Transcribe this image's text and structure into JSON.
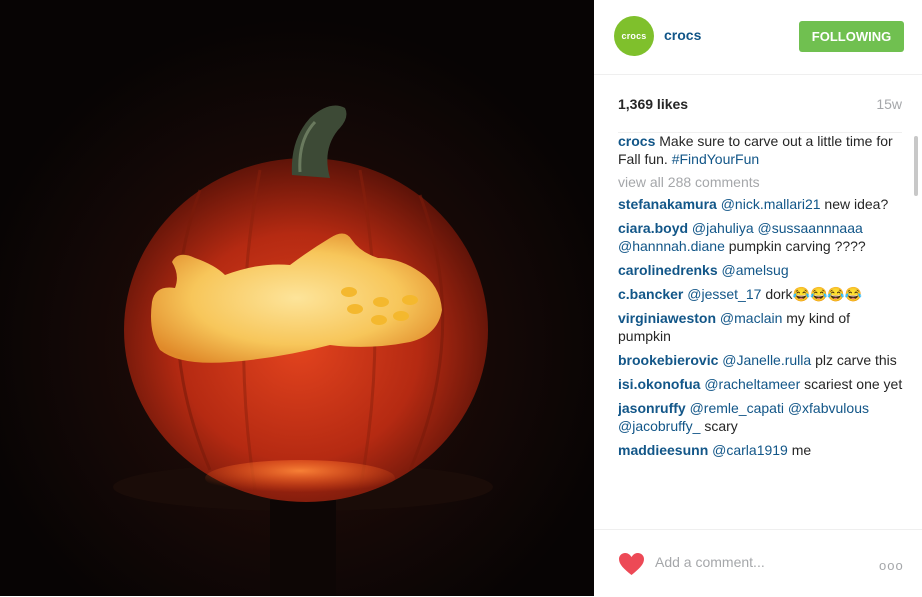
{
  "header": {
    "avatar_text": "crocs",
    "username": "crocs",
    "follow_label": "FOLLOWING",
    "avatar_color": "#7fc02c",
    "follow_color": "#70c050"
  },
  "meta": {
    "likes": "1,369 likes",
    "time": "15w"
  },
  "caption": {
    "author": "crocs",
    "text": "Make sure to carve out a little time for Fall fun.",
    "hashtag": "#FindYourFun"
  },
  "view_all": "view all 288 comments",
  "comments": [
    {
      "author": "stefanakamura",
      "mentions": "@nick.mallari21",
      "text": "new idea?"
    },
    {
      "author": "ciara.boyd",
      "mentions": "@jahuliya @sussaannnaaa @hannnah.diane",
      "text": "pumpkin carving ????"
    },
    {
      "author": "carolinedrenks",
      "mentions": "@amelsug",
      "text": ""
    },
    {
      "author": "c.bancker",
      "mentions": "@jesset_17",
      "text": "dork😂😂😂😂"
    },
    {
      "author": "virginiaweston",
      "mentions": "@maclain",
      "text": "my kind of pumpkin"
    },
    {
      "author": "brookebierovic",
      "mentions": "@Janelle.rulla",
      "text": "plz carve this"
    },
    {
      "author": "isi.okonofua",
      "mentions": "@racheltameer",
      "text": "scariest one yet"
    },
    {
      "author": "jasonruffy",
      "mentions": "@remle_capati @xfabvulous @jacobruffy_",
      "text": "scary"
    },
    {
      "author": "maddieesunn",
      "mentions": "@carla1919",
      "text": "me"
    }
  ],
  "footer": {
    "like_icon": "heart-icon",
    "add_comment_placeholder": "Add a comment...",
    "more_label": "ooo",
    "heart_color": "#ed4956"
  },
  "colors": {
    "link": "#125688",
    "muted": "#a5a7aa",
    "text": "#262626"
  }
}
